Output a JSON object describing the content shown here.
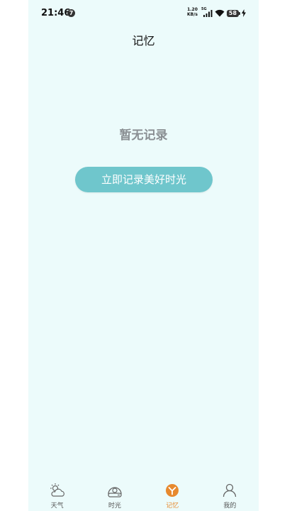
{
  "status_bar": {
    "time": "21:46",
    "notification_badge": "7",
    "net_speed_value": "1.20",
    "net_speed_unit": "KB/s",
    "network_type": "5G",
    "battery_level": "58"
  },
  "header": {
    "title": "记忆"
  },
  "main": {
    "empty_message": "暂无记录",
    "record_button_label": "立即记录美好时光"
  },
  "bottom_nav": {
    "items": [
      {
        "label": "天气",
        "icon": "weather-icon",
        "active": false
      },
      {
        "label": "时光",
        "icon": "time-icon",
        "active": false
      },
      {
        "label": "记忆",
        "icon": "memory-icon",
        "active": true
      },
      {
        "label": "我的",
        "icon": "profile-icon",
        "active": false
      }
    ]
  },
  "colors": {
    "background": "#ecfbfb",
    "button": "#6fc6cc",
    "active_nav": "#e7892e",
    "empty_text": "#8a8f93"
  }
}
